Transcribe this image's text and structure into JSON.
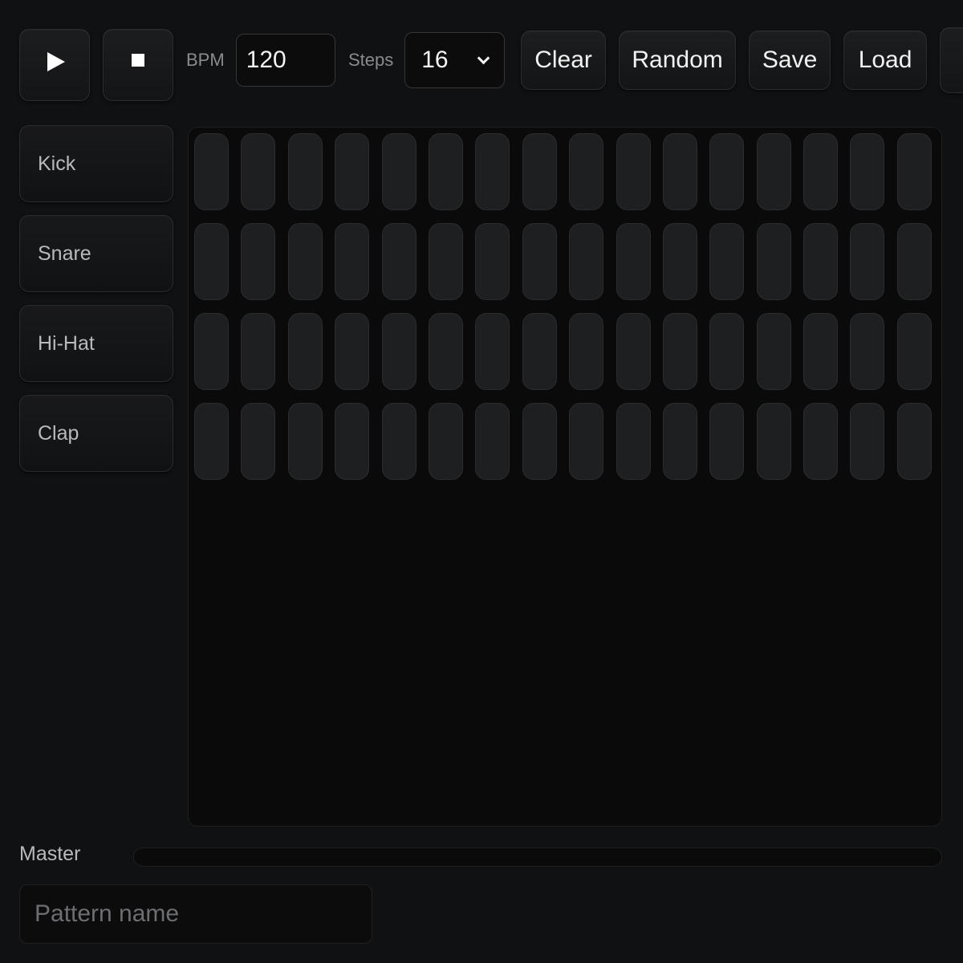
{
  "toolbar": {
    "play_icon": "play-icon",
    "stop_icon": "stop-icon",
    "bpm_label": "BPM",
    "bpm_value": "120",
    "steps_label": "Steps",
    "steps_value": "16",
    "clear_label": "Clear",
    "random_label": "Random",
    "save_label": "Save",
    "load_label": "Load"
  },
  "tracks": [
    {
      "label": "Kick"
    },
    {
      "label": "Snare"
    },
    {
      "label": "Hi-Hat"
    },
    {
      "label": "Clap"
    }
  ],
  "grid": {
    "steps": 16,
    "active_color": "#e6e6e6",
    "inactive_color": "#1e1f21"
  },
  "master": {
    "label": "Master",
    "level": 0
  },
  "pattern": {
    "placeholder": "Pattern name",
    "value": ""
  },
  "colors": {
    "background": "#101113",
    "panel": "#0a0a0b",
    "button": "#1c1d1f"
  }
}
